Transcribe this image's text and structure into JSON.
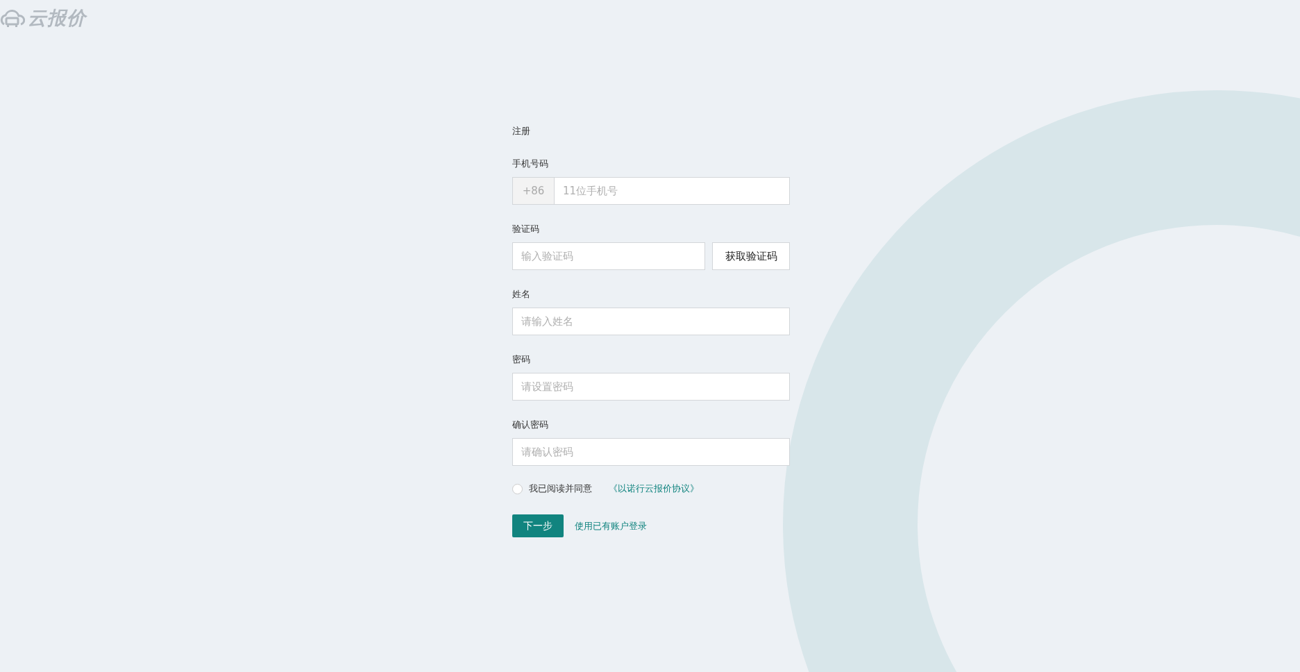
{
  "logo": {
    "text": "云报价"
  },
  "form": {
    "title": "注册",
    "fields": [
      {
        "kind": "phone",
        "label": "手机号码",
        "prefix": "+86",
        "placeholder": "11位手机号"
      },
      {
        "kind": "code",
        "label": "验证码",
        "placeholder": "输入验证码",
        "button": "获取验证码"
      },
      {
        "kind": "text",
        "label": "姓名",
        "placeholder": "请输入姓名"
      },
      {
        "kind": "password",
        "label": "密码",
        "placeholder": "请设置密码"
      },
      {
        "kind": "password",
        "label": "确认密码",
        "placeholder": "请确认密码"
      }
    ],
    "agreement": {
      "checked": false,
      "text": "我已阅读并同意",
      "link": "《以诺行云报价协议》"
    },
    "submit": "下一步",
    "login_link": "使用已有账户登录"
  }
}
